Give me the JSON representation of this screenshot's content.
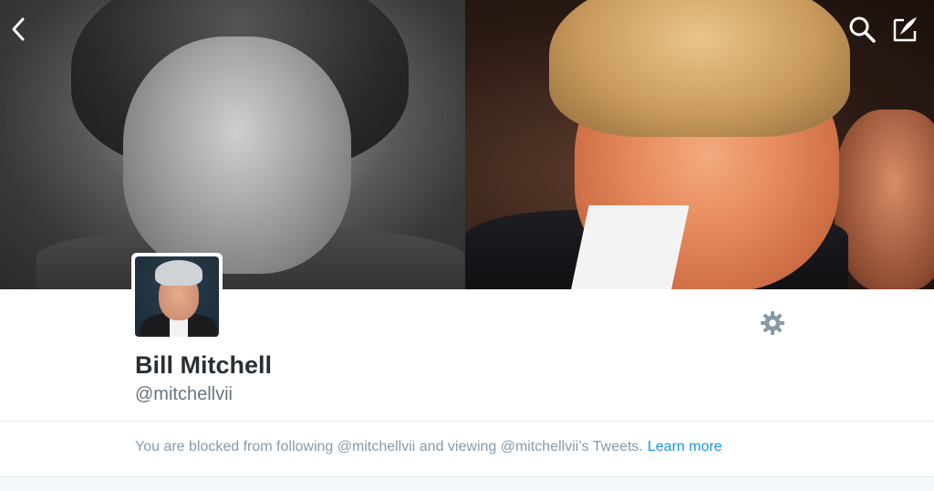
{
  "nav": {
    "back_icon": "chevron-left-icon",
    "search_icon": "search-icon",
    "compose_icon": "compose-icon"
  },
  "profile": {
    "display_name": "Bill Mitchell",
    "handle": "@mitchellvii",
    "settings_icon": "gear-icon"
  },
  "notice": {
    "message": "You are blocked from following @mitchellvii and viewing @mitchellvii’s Tweets.",
    "link_label": "Learn more"
  },
  "colors": {
    "name_text": "#292f33",
    "secondary_text": "#66757f",
    "notice_text": "#8899a6",
    "link": "#1b95e0",
    "gear": "#8899a6",
    "divider": "#e1e8ed"
  }
}
